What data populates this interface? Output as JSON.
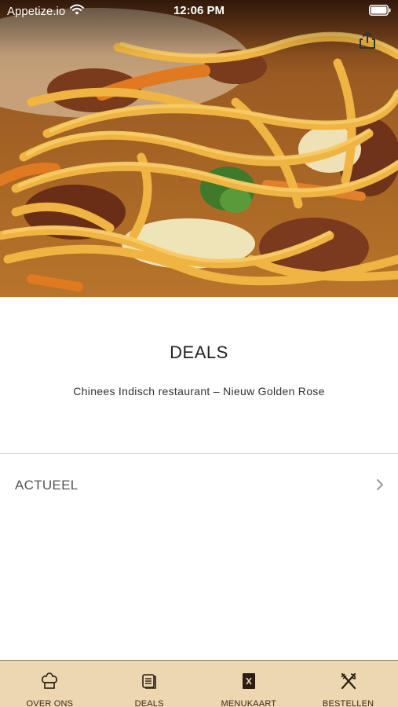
{
  "status_bar": {
    "carrier": "Appetize.io",
    "time": "12:06 PM"
  },
  "header": {
    "share_icon": "share-icon"
  },
  "page": {
    "title": "DEALS",
    "subtitle": "Chinees Indisch restaurant – Nieuw Golden Rose"
  },
  "list": {
    "items": [
      {
        "label": "ACTUEEL",
        "icon": "chevron-right-icon"
      }
    ]
  },
  "tab_bar": {
    "items": [
      {
        "label": "OVER ONS",
        "icon": "chef-hat-icon"
      },
      {
        "label": "DEALS",
        "icon": "scroll-icon"
      },
      {
        "label": "MENUKAART",
        "icon": "menu-card-icon"
      },
      {
        "label": "BESTELLEN",
        "icon": "cutlery-icon"
      }
    ],
    "background": "#ecd7b0"
  }
}
